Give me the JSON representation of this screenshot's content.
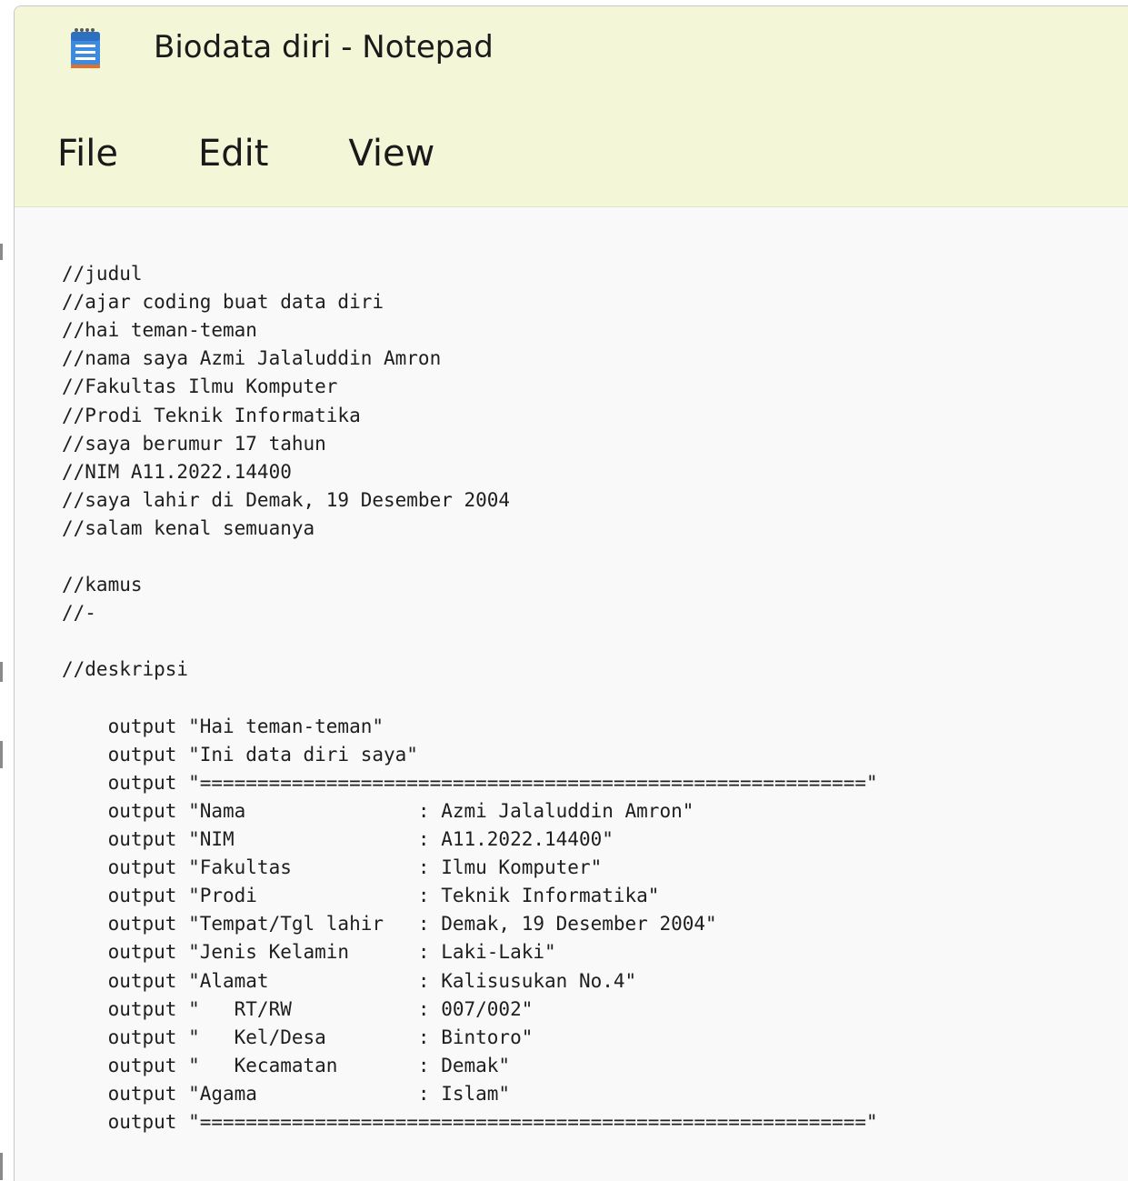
{
  "window": {
    "title": "Biodata diri - Notepad",
    "icon": "notepad-icon"
  },
  "menu": {
    "items": [
      "File",
      "Edit",
      "View"
    ]
  },
  "editor": {
    "lines": [
      "//judul",
      "//ajar coding buat data diri",
      "//hai teman-teman",
      "//nama saya Azmi Jalaluddin Amron",
      "//Fakultas Ilmu Komputer",
      "//Prodi Teknik Informatika",
      "//saya berumur 17 tahun",
      "//NIM A11.2022.14400",
      "//saya lahir di Demak, 19 Desember 2004",
      "//salam kenal semuanya",
      "",
      "//kamus",
      "//-",
      "",
      "//deskripsi",
      "",
      "    output \"Hai teman-teman\"",
      "    output \"Ini data diri saya\"",
      "    output \"==========================================================\"",
      "    output \"Nama               : Azmi Jalaluddin Amron\"",
      "    output \"NIM                : A11.2022.14400\"",
      "    output \"Fakultas           : Ilmu Komputer\"",
      "    output \"Prodi              : Teknik Informatika\"",
      "    output \"Tempat/Tgl lahir   : Demak, 19 Desember 2004\"",
      "    output \"Jenis Kelamin      : Laki-Laki\"",
      "    output \"Alamat             : Kalisusukan No.4\"",
      "    output \"   RT/RW           : 007/002\"",
      "    output \"   Kel/Desa        : Bintoro\"",
      "    output \"   Kecamatan       : Demak\"",
      "    output \"Agama              : Islam\"",
      "    output \"==========================================================\""
    ]
  },
  "colors": {
    "titlebar_bg": "#f4f6d8",
    "editor_bg": "#f9f9f9",
    "text": "#1e1e1e",
    "icon_blue": "#2f7fd6",
    "icon_orange": "#e0702a"
  }
}
